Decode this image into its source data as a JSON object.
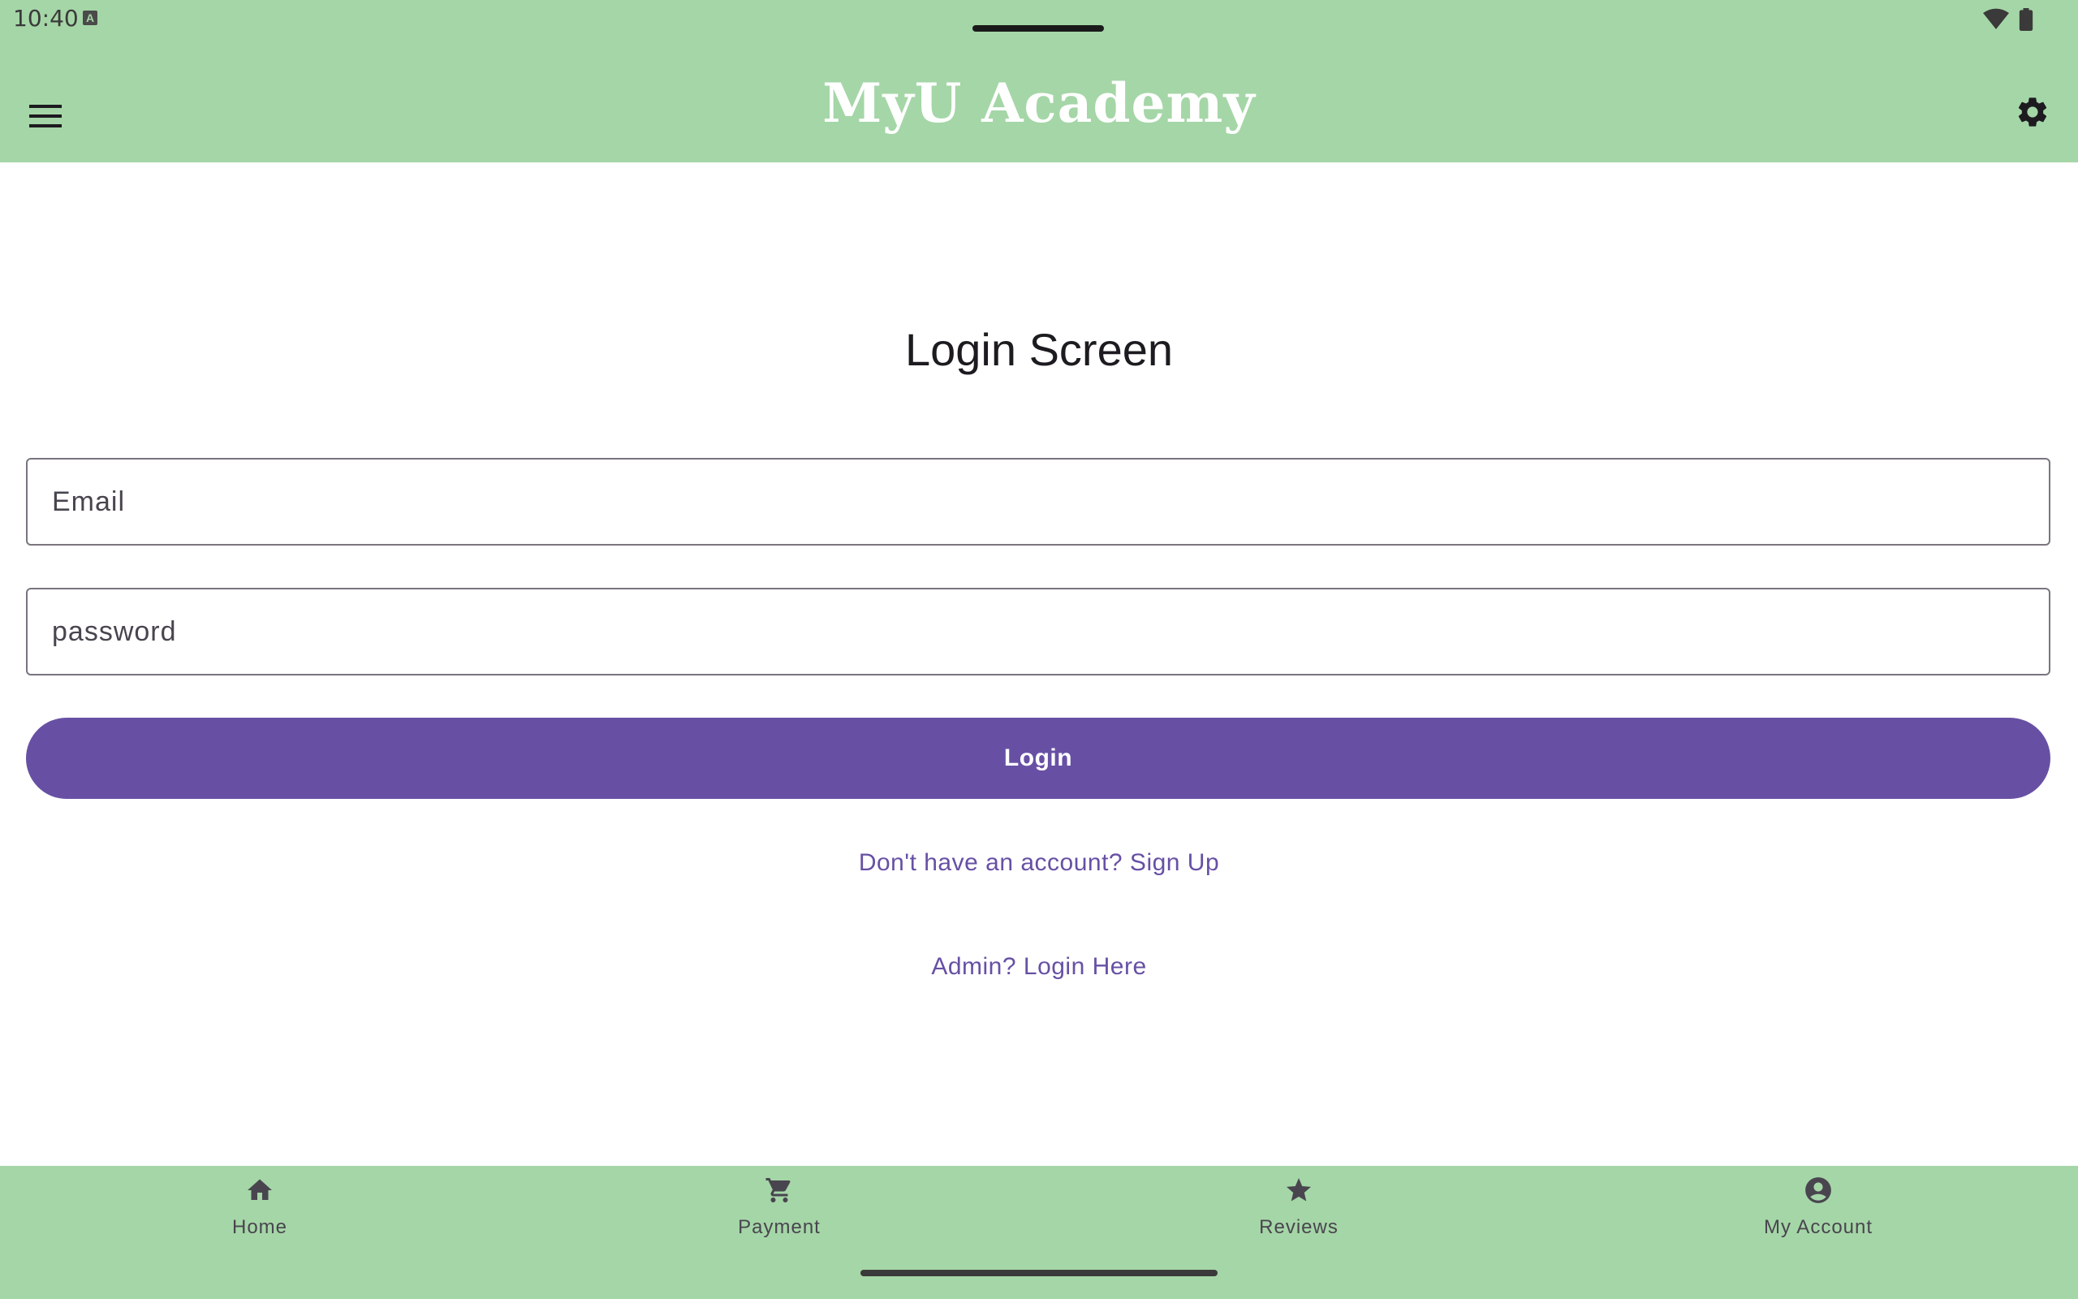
{
  "status_bar": {
    "time": "10:40",
    "indicator_letter": "A"
  },
  "app_bar": {
    "title": "MyU Academy",
    "menu_icon": "menu-icon",
    "settings_icon": "gear-icon"
  },
  "main": {
    "screen_title": "Login Screen",
    "email_placeholder": "Email",
    "password_placeholder": "password",
    "login_label": "Login",
    "signup_link": "Don't have an account? Sign Up",
    "admin_link": "Admin? Login Here"
  },
  "bottom_nav": {
    "items": [
      {
        "label": "Home",
        "icon": "home-icon"
      },
      {
        "label": "Payment",
        "icon": "cart-icon"
      },
      {
        "label": "Reviews",
        "icon": "star-icon"
      },
      {
        "label": "My Account",
        "icon": "account-circle-icon"
      }
    ]
  },
  "colors": {
    "app_bar": "#a5d6a7",
    "primary": "#6750a4",
    "outline": "#79747e"
  }
}
